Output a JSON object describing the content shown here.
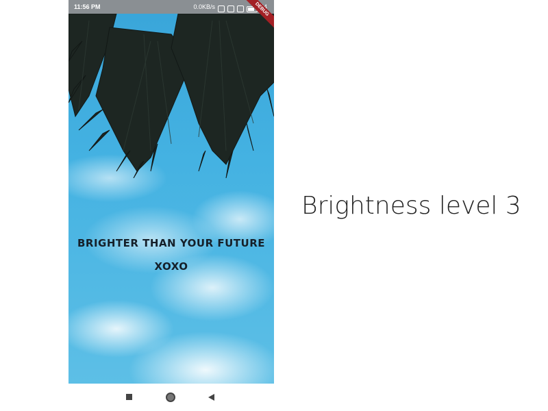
{
  "status_bar": {
    "time": "11:56 PM",
    "network_speed": "0.0KB/s",
    "battery_level": "44"
  },
  "debug_banner": {
    "label": "DEBUG"
  },
  "wallpaper": {
    "line1": "BRIGHTER THAN YOUR FUTURE",
    "line2": "XOXO"
  },
  "nav": {
    "recents_icon": "square-icon",
    "home_icon": "circle-icon",
    "back_icon": "triangle-back-icon"
  },
  "caption": "Brightness level 3",
  "colors": {
    "sky": "#44b2e2",
    "palm": "#1d2622",
    "debug": "#a32025"
  }
}
